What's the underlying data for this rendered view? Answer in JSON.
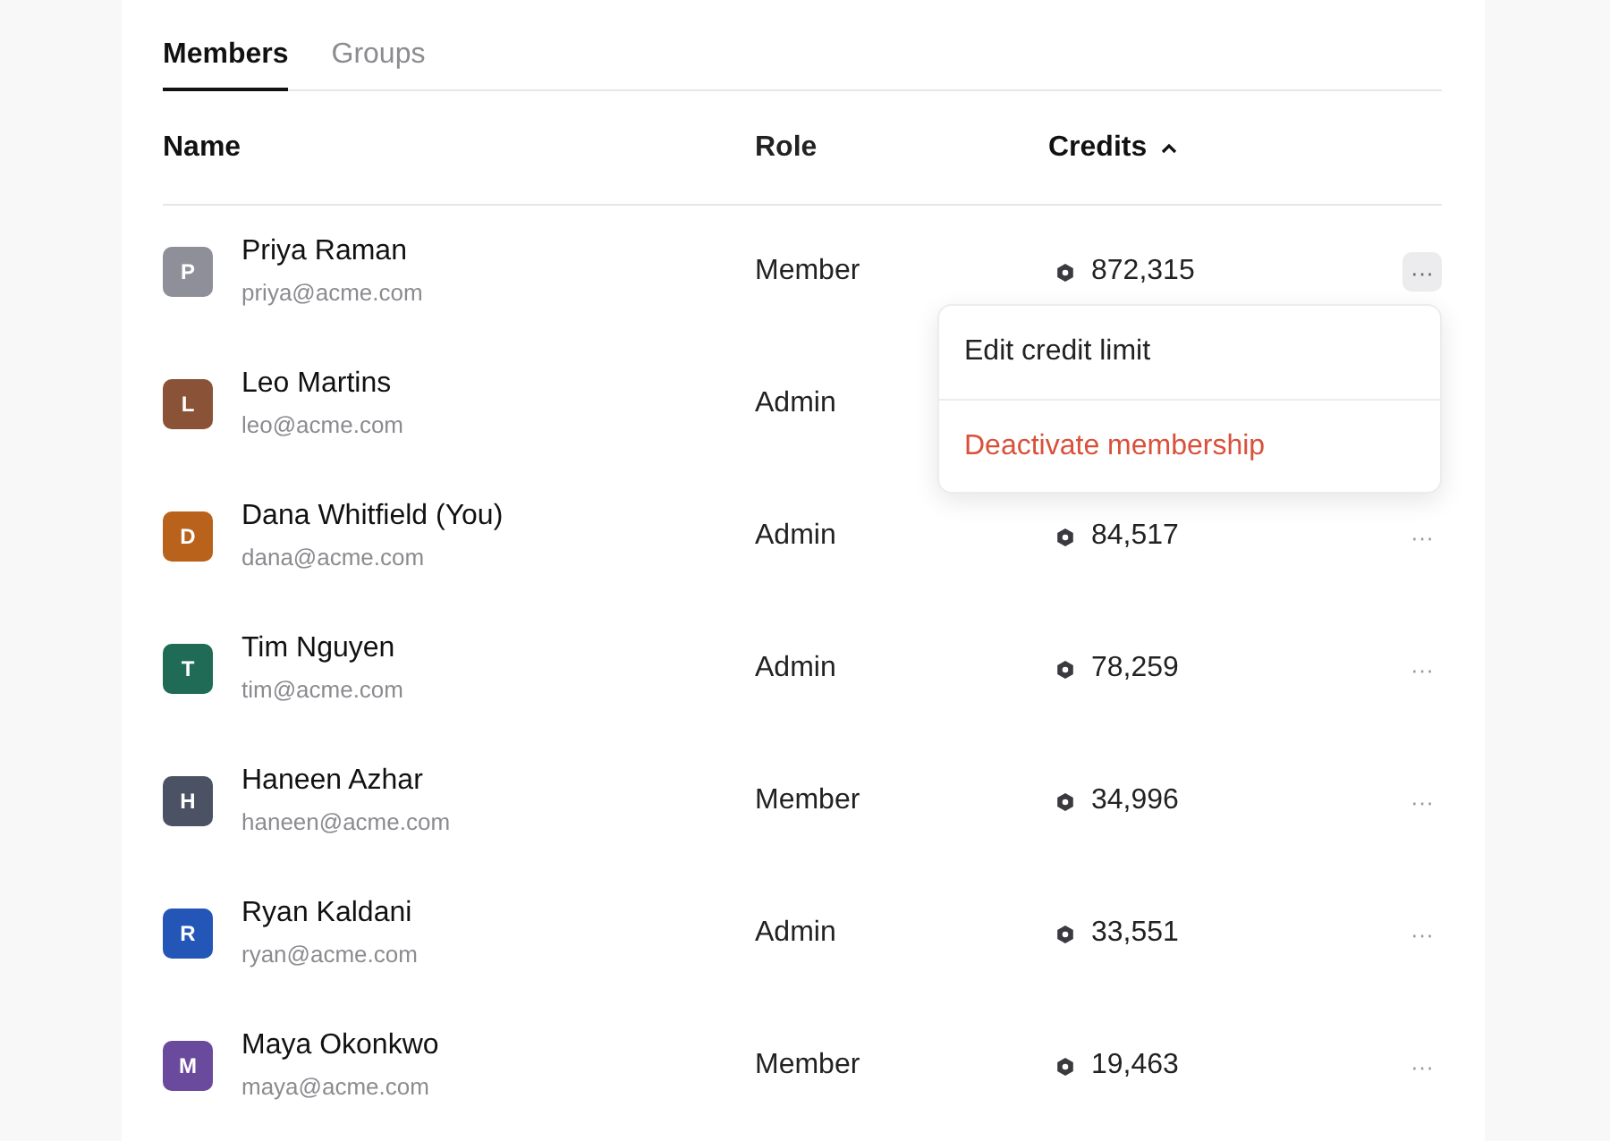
{
  "tabs": [
    {
      "label": "Members",
      "selected": true
    },
    {
      "label": "Groups",
      "selected": false
    }
  ],
  "columns": [
    {
      "label": "Name"
    },
    {
      "label": "Role"
    },
    {
      "label": "Credits",
      "sorted_ascending": true
    }
  ],
  "members": [
    {
      "initial": "P",
      "color": "#8e8f99",
      "name": "Priya Raman",
      "email": "priya@acme.com",
      "role": "Member",
      "credits": "872,315",
      "actions": "···",
      "selected": true
    },
    {
      "initial": "L",
      "color": "#8a5236",
      "name": "Leo Martins",
      "email": "leo@acme.com",
      "role": "Admin",
      "selected": false
    },
    {
      "initial": "D",
      "color": "#b8621c",
      "name": "Dana Whitfield (You)",
      "email": "dana@acme.com",
      "role": "Admin",
      "credits": "84,517",
      "actions": "···",
      "selected": false
    },
    {
      "initial": "T",
      "color": "#1f6b56",
      "name": "Tim Nguyen",
      "email": "tim@acme.com",
      "role": "Admin",
      "credits": "78,259",
      "actions": "···",
      "selected": false
    },
    {
      "initial": "H",
      "color": "#4a5263",
      "name": "Haneen Azhar",
      "email": "haneen@acme.com",
      "role": "Member",
      "credits": "34,996",
      "actions": "···",
      "selected": false
    },
    {
      "initial": "R",
      "color": "#2456b8",
      "name": "Ryan Kaldani",
      "email": "ryan@acme.com",
      "role": "Admin",
      "credits": "33,551",
      "actions": "···",
      "selected": false
    },
    {
      "initial": "M",
      "color": "#6a4a9c",
      "name": "Maya Okonkwo",
      "email": "maya@acme.com",
      "role": "Member",
      "credits": "19,463",
      "actions": "···",
      "selected": false
    }
  ],
  "menu": {
    "items": [
      {
        "label": "Edit credit limit",
        "kind": "default"
      },
      {
        "label": "Deactivate membership",
        "kind": "destructive"
      }
    ]
  }
}
